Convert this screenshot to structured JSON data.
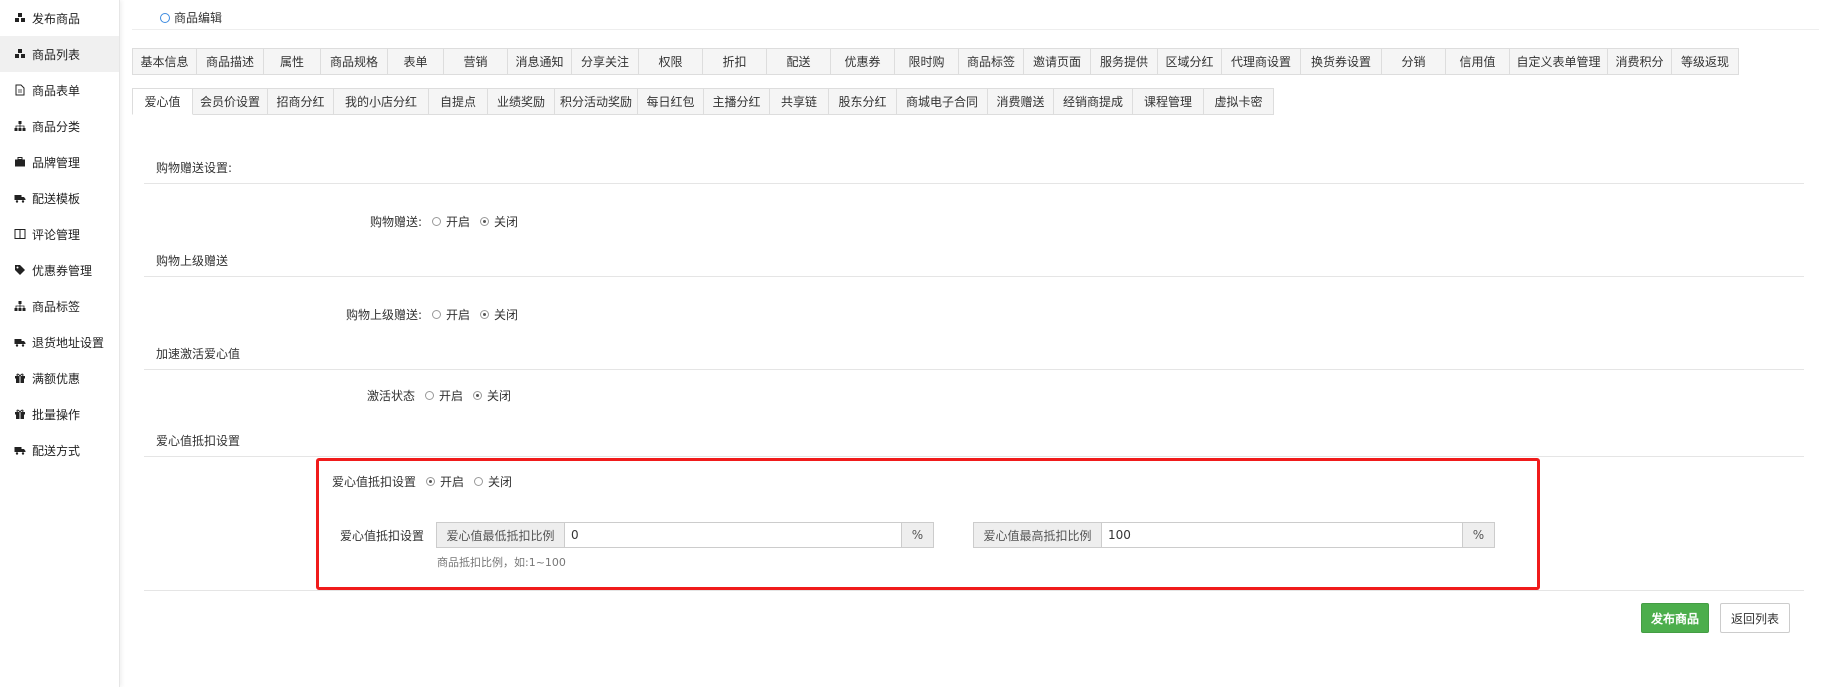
{
  "sidebar": {
    "items": [
      {
        "label": "发布商品",
        "icon": "cubes-icon"
      },
      {
        "label": "商品列表",
        "icon": "cubes-icon"
      },
      {
        "label": "商品表单",
        "icon": "file-icon"
      },
      {
        "label": "商品分类",
        "icon": "sitemap-icon"
      },
      {
        "label": "品牌管理",
        "icon": "briefcase-icon"
      },
      {
        "label": "配送模板",
        "icon": "truck-icon"
      },
      {
        "label": "评论管理",
        "icon": "columns-icon"
      },
      {
        "label": "优惠券管理",
        "icon": "tags-icon"
      },
      {
        "label": "商品标签",
        "icon": "sitemap-icon"
      },
      {
        "label": "退货地址设置",
        "icon": "truck-icon"
      },
      {
        "label": "满额优惠",
        "icon": "gift-icon"
      },
      {
        "label": "批量操作",
        "icon": "gift-icon"
      },
      {
        "label": "配送方式",
        "icon": "truck-icon"
      }
    ],
    "active_index": 1
  },
  "header": {
    "title": "商品编辑"
  },
  "tabs_row1": [
    "基本信息",
    "商品描述",
    "属性",
    "商品规格",
    "表单",
    "营销",
    "消息通知",
    "分享关注",
    "权限",
    "折扣",
    "配送",
    "优惠券",
    "限时购",
    "商品标签",
    "邀请页面",
    "服务提供",
    "区域分红",
    "代理商设置",
    "换货券设置",
    "分销",
    "信用值",
    "自定义表单管理",
    "消费积分",
    "等级返现"
  ],
  "tabs_row2": [
    "爱心值",
    "会员价设置",
    "招商分红",
    "我的小店分红",
    "自提点",
    "业绩奖励",
    "积分活动奖励",
    "每日红包",
    "主播分红",
    "共享链",
    "股东分红",
    "商城电子合同",
    "消费赠送",
    "经销商提成",
    "课程管理",
    "虚拟卡密"
  ],
  "active_tab_row2": "爱心值",
  "sections": {
    "shopping_gift": {
      "title": "购物赠送设置:",
      "field_label": "购物赠送:",
      "on_label": "开启",
      "off_label": "关闭",
      "selected": "关闭"
    },
    "parent_gift": {
      "title": "购物上级赠送",
      "field_label": "购物上级赠送:",
      "on_label": "开启",
      "off_label": "关闭",
      "selected": "关闭"
    },
    "activation": {
      "title": "加速激活爱心值",
      "field_label": "激活状态",
      "on_label": "开启",
      "off_label": "关闭",
      "selected": "关闭"
    },
    "deduction": {
      "title": "爱心值抵扣设置",
      "switch_label": "爱心值抵扣设置",
      "on_label": "开启",
      "off_label": "关闭",
      "selected": "开启",
      "ratio_label": "爱心值抵扣设置",
      "min_addon": "爱心值最低抵扣比例",
      "min_value": "0",
      "max_addon": "爱心值最高抵扣比例",
      "max_value": "100",
      "percent": "%",
      "hint": "商品抵扣比例，如:1~100"
    }
  },
  "actions": {
    "publish_label": "发布商品",
    "back_label": "返回列表"
  },
  "colors": {
    "accent": "#3d8be0",
    "highlight_border": "#f01b1b",
    "publish_button": "#4cae4c"
  }
}
